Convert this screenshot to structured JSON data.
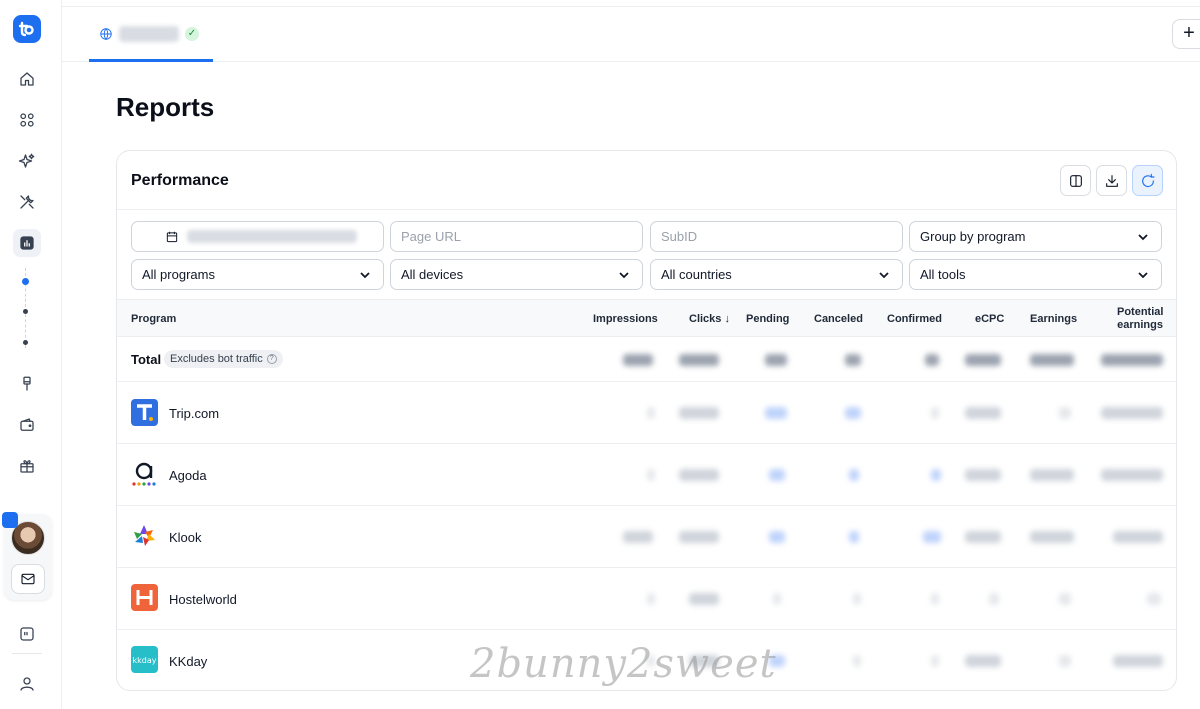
{
  "sidebar": {
    "nav": [
      "home-icon",
      "apps-icon",
      "sparkles-icon",
      "tools-icon",
      "reports-icon",
      "brush-icon",
      "wallet-icon",
      "gift-icon",
      "quote-icon",
      "user-icon"
    ]
  },
  "tabs": {
    "add_label": "+"
  },
  "page": {
    "title": "Reports"
  },
  "card": {
    "title": "Performance",
    "filters": {
      "page_url_placeholder": "Page URL",
      "subid_placeholder": "SubID",
      "group_by": "Group by program",
      "programs": "All programs",
      "devices": "All devices",
      "countries": "All countries",
      "tools": "All tools"
    },
    "columns": {
      "program": "Program",
      "impressions": "Impressions",
      "clicks": "Clicks ↓",
      "pending": "Pending",
      "canceled": "Canceled",
      "confirmed": "Confirmed",
      "ecpc": "eCPC",
      "earnings": "Earnings",
      "potential_1": "Potential",
      "potential_2": "earnings"
    },
    "total": {
      "label": "Total",
      "badge": "Excludes bot traffic"
    },
    "programs": [
      {
        "name": "Trip.com",
        "color": "#2f6fe0"
      },
      {
        "name": "Agoda",
        "color": "#111827"
      },
      {
        "name": "Klook",
        "color": "#ff5b00"
      },
      {
        "name": "Hostelworld",
        "color": "#f0643c"
      },
      {
        "name": "KKday",
        "color": "#26bec9"
      }
    ]
  },
  "watermark": "2bunny2sweet",
  "colors": {
    "accent": "#1e6ff0"
  }
}
